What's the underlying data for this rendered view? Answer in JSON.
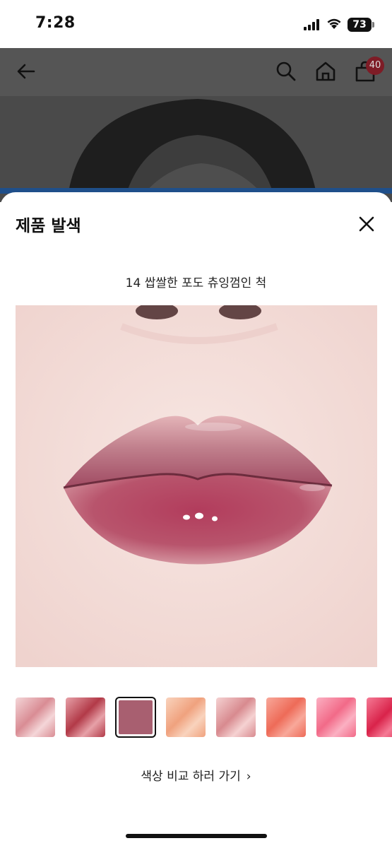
{
  "status": {
    "time": "7:28",
    "battery": "73"
  },
  "header": {
    "back_icon": "arrow-left-icon",
    "search_icon": "search-icon",
    "home_icon": "home-icon",
    "cart_icon": "shopping-bag-icon",
    "cart_count": "40"
  },
  "sheet": {
    "title": "제품 발색",
    "close_icon": "close-icon",
    "product_name": "14 쌉쌀한 포도 츄잉껌인 척",
    "compare_label": "색상 비교 하러 가기",
    "compare_chevron": "›"
  },
  "swatches": [
    {
      "color": "#d98c94",
      "accent": "#f4d6d8",
      "selected": false
    },
    {
      "color": "#b23a48",
      "accent": "#e7a1a8",
      "selected": false
    },
    {
      "color": "#a85f70",
      "accent": "#c98a98",
      "selected": true
    },
    {
      "color": "#f0a27e",
      "accent": "#f9d3bd",
      "selected": false
    },
    {
      "color": "#d88a8f",
      "accent": "#f5d2d2",
      "selected": false
    },
    {
      "color": "#ee6b58",
      "accent": "#f8a89a",
      "selected": false
    },
    {
      "color": "#f26a88",
      "accent": "#fbb0c2",
      "selected": false
    },
    {
      "color": "#d9234a",
      "accent": "#f57a95",
      "selected": false
    }
  ],
  "colors": {
    "lip": "#b5506a",
    "skin": "#f6e1dd",
    "dim_overlay": "#555555",
    "badge": "#7e1c26"
  }
}
